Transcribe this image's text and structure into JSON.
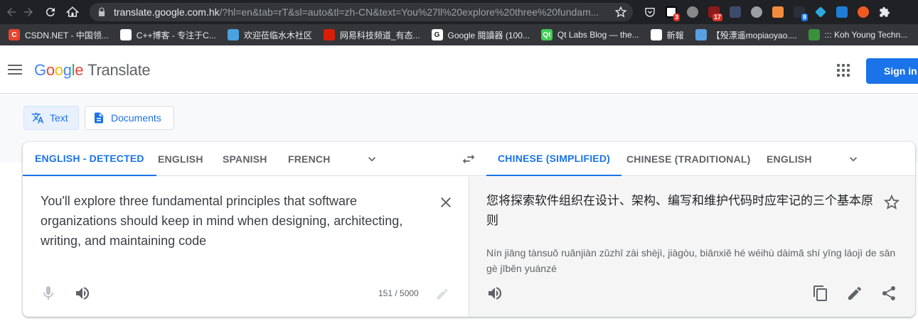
{
  "browser": {
    "url_host": "translate.google.com.hk",
    "url_rest": "/?hl=en&tab=rT&sl=auto&tl=zh-CN&text=You%27ll%20explore%20three%20fundam...",
    "extension_badges": [
      "3",
      "17",
      "8"
    ]
  },
  "bookmarks": [
    {
      "label": "CSDN.NET - 中国领...",
      "icon": "csdn-icon",
      "icon_text": "C",
      "color": "#e8442e"
    },
    {
      "label": "C++博客 - 专注于C...",
      "icon": "globe-icon",
      "icon_text": "",
      "color": "#ffffff"
    },
    {
      "label": "欢迎莅临水木社区",
      "icon": "newsmth-icon",
      "icon_text": "",
      "color": "#4aa3df"
    },
    {
      "label": "网易科技频道_有态...",
      "icon": "netease-icon",
      "icon_text": "",
      "color": "#d81e06"
    },
    {
      "label": "Google 閱讀器 (100...",
      "icon": "google-icon",
      "icon_text": "G",
      "color": "#ffffff"
    },
    {
      "label": "Qt Labs Blog — the...",
      "icon": "qt-icon",
      "icon_text": "Qt",
      "color": "#41cd52"
    },
    {
      "label": "新報",
      "icon": "globe-icon",
      "icon_text": "",
      "color": "#ffffff"
    },
    {
      "label": "【殁漂遥mopiaoyao....",
      "icon": "mopiaoyao-icon",
      "icon_text": "",
      "color": "#5aa0e0"
    },
    {
      "label": "::: Koh Young Techn...",
      "icon": "kohyoung-icon",
      "icon_text": "",
      "color": "#3a8f3a"
    }
  ],
  "header": {
    "logo_letters": [
      "G",
      "o",
      "o",
      "g",
      "l",
      "e"
    ],
    "product": "Translate",
    "sign_in": "Sign in"
  },
  "modes": {
    "text": "Text",
    "documents": "Documents"
  },
  "source_langs": [
    "ENGLISH - DETECTED",
    "ENGLISH",
    "SPANISH",
    "FRENCH"
  ],
  "target_langs": [
    "CHINESE (SIMPLIFIED)",
    "CHINESE (TRADITIONAL)",
    "ENGLISH"
  ],
  "source": {
    "text": "You'll explore three fundamental principles that software organizations should keep in mind when designing, architecting, writing, and maintaining code",
    "char_count": "151 / 5000"
  },
  "target": {
    "text": "您将探索软件组织在设计、架构、编写和维护代码时应牢记的三个基本原则",
    "pinyin": "Nín jiāng tànsuǒ ruǎnjiàn zǔzhī zài shèjì, jiàgòu, biānxiě hé wéihù dàimǎ shí yīng láojì de sān gè jīběn yuánzé"
  },
  "colors": {
    "accent": "#1a73e8",
    "chrome_dark": "#202124"
  }
}
